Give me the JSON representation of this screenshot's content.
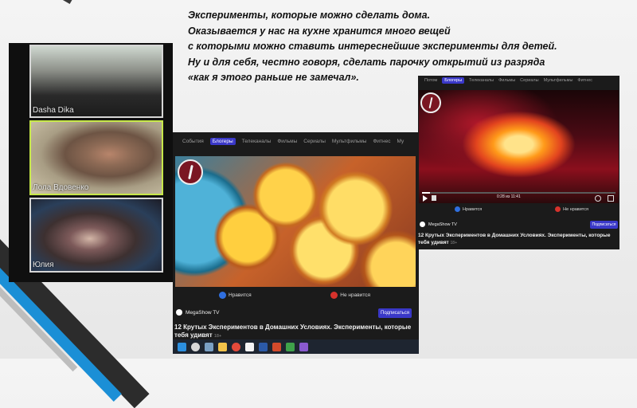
{
  "intro": {
    "lines": [
      "Эксперименты, которые можно сделать дома.",
      "Оказывается у нас на кухне хранится много вещей",
      " с которыми можно ставить интереснейшие  эксперименты для детей.",
      " Ну и для себя, честно говоря, сделать парочку открытий из разряда",
      " «как я этого раньше не замечал»."
    ]
  },
  "participants": [
    {
      "name": "Dasha Dika"
    },
    {
      "name": "Лола Вдовенко"
    },
    {
      "name": "Юлия"
    }
  ],
  "browser_main": {
    "nav": [
      "События",
      "Блогеры",
      "Телеканалы",
      "Фильмы",
      "Сериалы",
      "Мультфильмы",
      "Фитнес",
      "Му"
    ],
    "active_tab": "Блогеры",
    "like_label": "Нравится",
    "dislike_label": "Не нравится",
    "channel": "MegaShow TV",
    "subscribe_label": "Подписаться",
    "title": "12 Крутых Экспериментов в Домашних Условиях. Эксперименты, которые тебя удивят",
    "age": "18+"
  },
  "browser_right": {
    "nav": [
      "Потом",
      "Блогеры",
      "Телеканалы",
      "Фильмы",
      "Сериалы",
      "Мультфильмы",
      "Фитнес"
    ],
    "active_tab": "Блогеры",
    "time": "0:28 из 11:41",
    "like_label": "Нравится",
    "dislike_label": "Не нравится",
    "channel": "MegaShow TV",
    "subscribe_label": "Подписаться",
    "title": "12 Крутых Экспериментов в Домашних Условиях. Эксперименты, которые тебя удивят",
    "age": "18+"
  },
  "colors": {
    "accent": "#3a38c8",
    "like": "#2f6fe0",
    "dislike": "#d6322c",
    "stripe_blue": "#1b8fd6",
    "stripe_dark": "#2c2c2c"
  },
  "taskbar_icons": [
    "windows-icon",
    "search-icon",
    "taskview-icon",
    "explorer-icon",
    "chrome-icon",
    "yandex-icon",
    "word-icon",
    "powerpoint-icon"
  ]
}
